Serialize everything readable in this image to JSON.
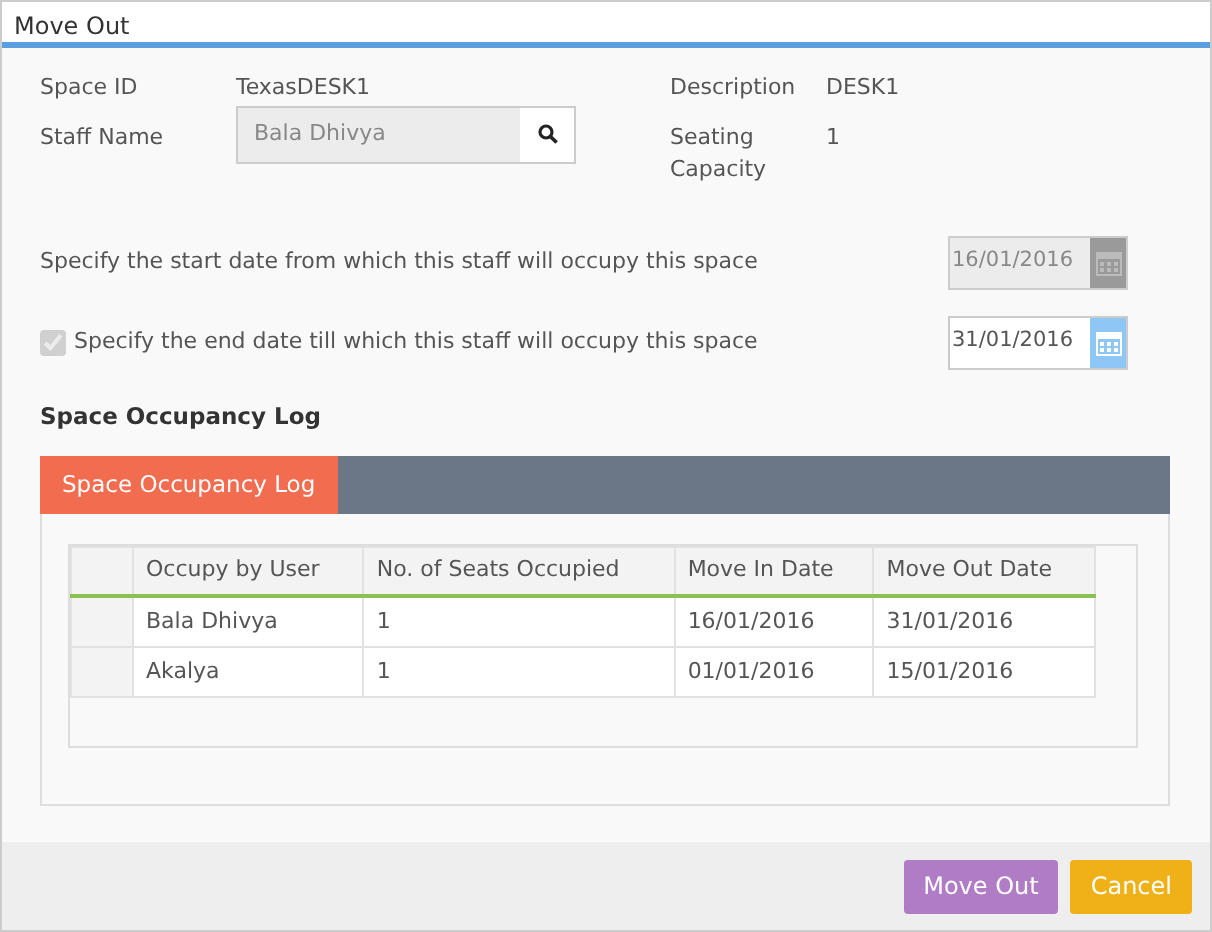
{
  "window": {
    "title": "Move Out"
  },
  "details": [
    {
      "label": "Space ID",
      "value": "TexasDESK1"
    },
    {
      "label": "Description",
      "value": "DESK1"
    },
    {
      "label": "Staff Name",
      "kind": "input",
      "value": "Bala Dhivya"
    },
    {
      "label": "Seating Capacity",
      "value": "1"
    }
  ],
  "start_date": {
    "label": "Specify the start date from which this staff will occupy this space",
    "value": "16/01/2016",
    "disabled": true
  },
  "end_date": {
    "label": "Specify the end date till which this staff will occupy this space",
    "value": "31/01/2016",
    "disabled": false,
    "checked": true
  },
  "section_title": "Space Occupancy Log",
  "tabs": [
    {
      "label": "Space Occupancy Log",
      "selected": true
    }
  ],
  "table": {
    "columns": [
      "Occupy by User",
      "No. of Seats Occupied",
      "Move In Date",
      "Move Out Date"
    ],
    "rows": [
      [
        "Bala Dhivya",
        "1",
        "16/01/2016",
        "31/01/2016"
      ],
      [
        "Akalya",
        "1",
        "01/01/2016",
        "15/01/2016"
      ]
    ]
  },
  "buttons": [
    {
      "label": "Move Out",
      "kind": "primary"
    },
    {
      "label": "Cancel",
      "kind": "cancel"
    }
  ]
}
